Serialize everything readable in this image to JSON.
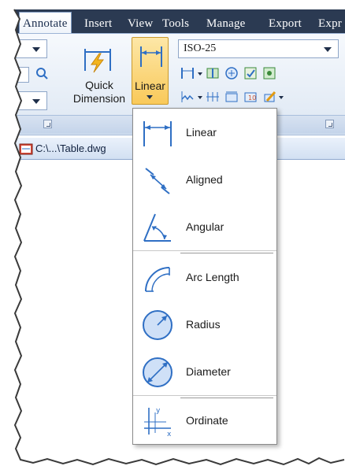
{
  "ribbon": {
    "tabs": [
      "Annotate",
      "Insert",
      "View",
      "Tools",
      "Manage",
      "Export",
      "Expr"
    ],
    "active_tab": "Annotate",
    "quick_dimension_label_line1": "Quick",
    "quick_dimension_label_line2": "Dimension",
    "linear_button_label": "Linear",
    "dim_style_value": "ISO-25"
  },
  "file_tab": {
    "label": "C:\\...\\Table.dwg"
  },
  "dimension_menu": {
    "items": [
      {
        "label": "Linear",
        "icon": "linear-dimension-icon"
      },
      {
        "label": "Aligned",
        "icon": "aligned-dimension-icon"
      },
      {
        "label": "Angular",
        "icon": "angular-dimension-icon"
      },
      {
        "label": "Arc Length",
        "icon": "arc-length-icon"
      },
      {
        "label": "Radius",
        "icon": "radius-icon"
      },
      {
        "label": "Diameter",
        "icon": "diameter-icon"
      },
      {
        "label": "Ordinate",
        "icon": "ordinate-icon"
      }
    ]
  },
  "colors": {
    "tab_bar": "#2b3a52",
    "active_button": "#f9c95a",
    "icon_blue": "#2f6fc4"
  }
}
